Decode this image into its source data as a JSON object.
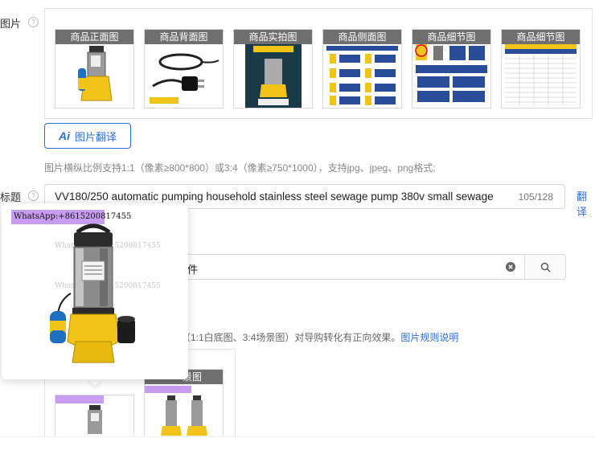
{
  "images_field": {
    "label": "图片",
    "thumbnails": [
      {
        "caption": "商品正面图",
        "art": "pump-front"
      },
      {
        "caption": "商品背面图",
        "art": "power-cable"
      },
      {
        "caption": "商品实拍图",
        "art": "pump-photo"
      },
      {
        "caption": "商品侧面图",
        "art": "spec-grid"
      },
      {
        "caption": "商品细节图",
        "art": "detail-grid"
      },
      {
        "caption": "商品细节图",
        "art": "spec-table"
      }
    ],
    "ai_translate_glyph": "Ai",
    "ai_translate_label": "图片翻译",
    "hint": "图片横纵比例支持1:1（像素≥800*800）或3:4（像素≥750*1000），支持jpg、jpeg、png格式;"
  },
  "title_field": {
    "label": "标题",
    "value": "VV180/250 automatic pumping household stainless steel sewage pump 380v small sewage",
    "count": "105/128",
    "translate_link": "翻译"
  },
  "search": {
    "value": "件",
    "clear_icon": "clear-icon",
    "search_icon": "search-icon"
  },
  "rule_hint": {
    "text": "（1:1白底图、3:4场景图）对导购转化有正向效果。",
    "link": "图片规则说明"
  },
  "lower_panel": {
    "caption_partial": "景图"
  },
  "popup": {
    "watermark": "WhatsApp:+8615200817455",
    "ghost_1": "WhatsApp:+8615200817455",
    "ghost_2": "WhatsApp:+8615200817455"
  },
  "colors": {
    "accent": "#2f6fd6",
    "pump_yellow": "#f2c318",
    "float_blue": "#1d6fc2",
    "badge_purple": "#c89cf0"
  }
}
